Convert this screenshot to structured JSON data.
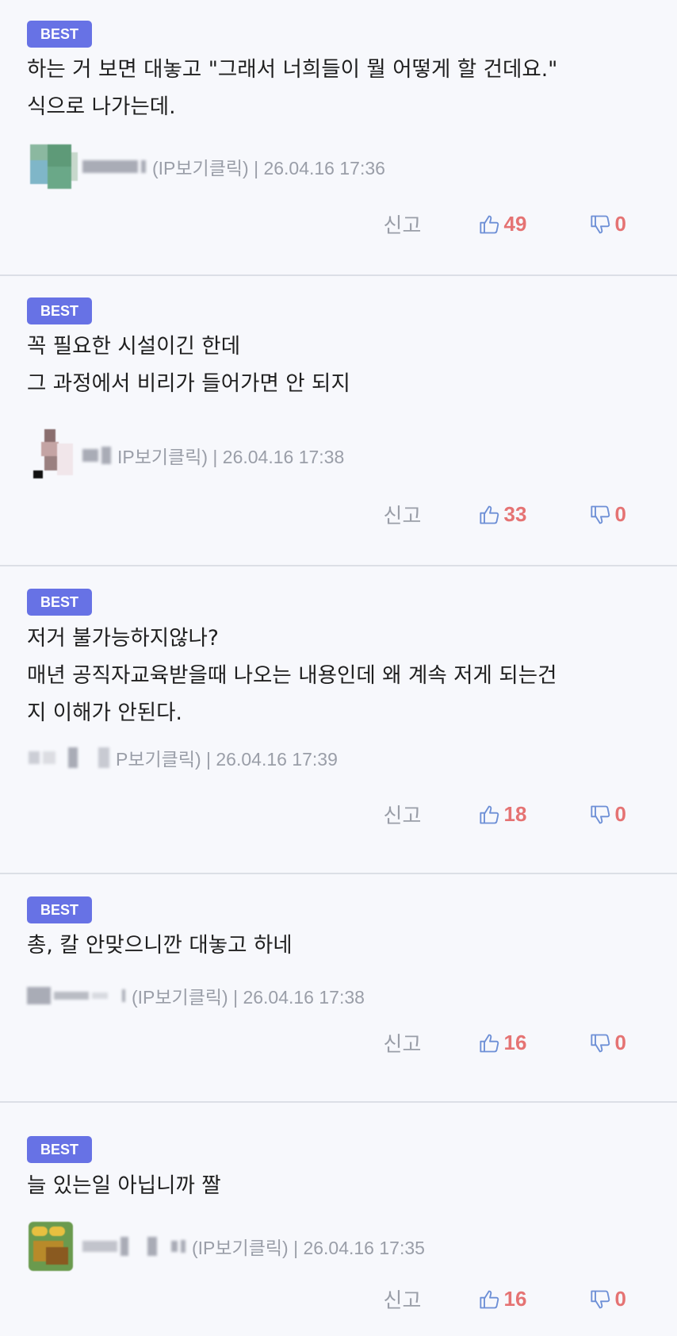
{
  "badge_label": "BEST",
  "report_label": "신고",
  "colors": {
    "badge": "#6772e5",
    "count": "#e57373",
    "meta": "#9a9ea8",
    "divider": "#dcdfe6"
  },
  "comments": [
    {
      "lines": [
        "하는 거 보면 대놓고 \"그래서 너희들이 뭘 어떻게 할 건데요.\"",
        "식으로 나가는데."
      ],
      "meta": "(IP보기클릭) | 26.04.16 17:36",
      "likes": "49",
      "dislikes": "0"
    },
    {
      "lines": [
        "꼭 필요한 시설이긴 한데",
        "그 과정에서 비리가 들어가면 안 되지"
      ],
      "meta": "IP보기클릭) | 26.04.16 17:38",
      "likes": "33",
      "dislikes": "0"
    },
    {
      "lines": [
        "저거 불가능하지않나?",
        "매년 공직자교육받을때 나오는 내용인데 왜 계속 저게 되는건",
        "지 이해가 안된다."
      ],
      "meta": "P보기클릭) | 26.04.16 17:39",
      "likes": "18",
      "dislikes": "0"
    },
    {
      "lines": [
        "총, 칼 안맞으니깐 대놓고 하네"
      ],
      "meta": "(IP보기클릭) | 26.04.16 17:38",
      "likes": "16",
      "dislikes": "0"
    },
    {
      "lines": [
        "늘 있는일 아닙니까 짤"
      ],
      "meta": "(IP보기클릭) | 26.04.16 17:35",
      "likes": "16",
      "dislikes": "0"
    }
  ]
}
